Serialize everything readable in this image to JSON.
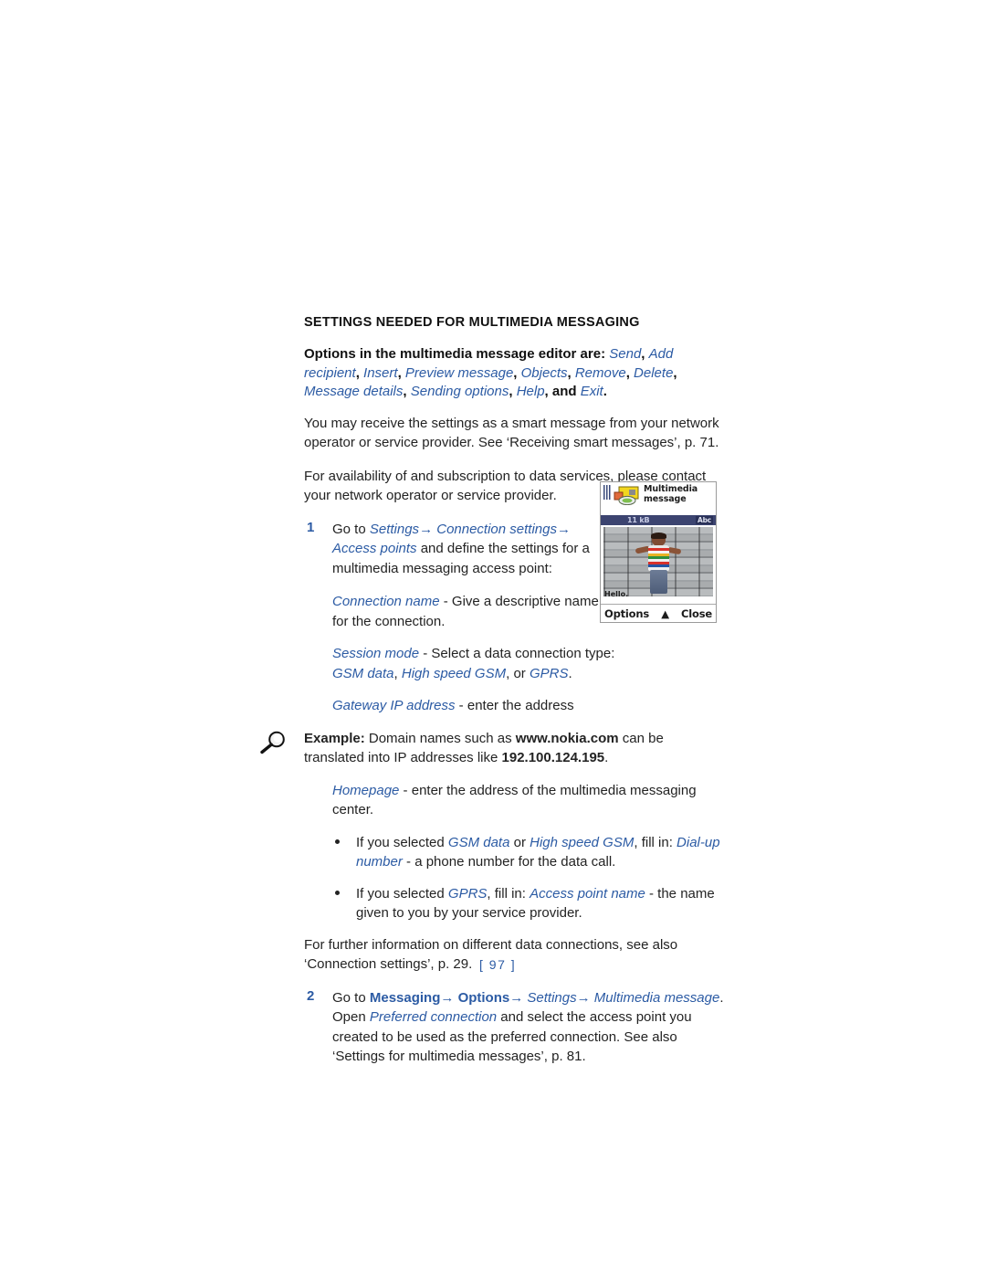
{
  "page": {
    "number_label": "[ 97 ]",
    "accent_blue": "#2c5ba4",
    "body_color": "#232323"
  },
  "section": {
    "title": "SETTINGS NEEDED FOR MULTIMEDIA MESSAGING"
  },
  "lead": {
    "prefix": "Options in the multimedia message editor are:",
    "options": [
      "Send",
      "Add recipient",
      "Insert",
      "Preview message",
      "Objects",
      "Remove",
      "Delete",
      "Message details",
      "Sending options",
      "Help",
      "Exit"
    ],
    "connector_and": ", and ",
    "terminator": "."
  },
  "paragraphs": {
    "smart_message": "You may receive the settings as a smart message from your network operator or service provider. See ‘Receiving smart messages’, p. 71.",
    "availability": "For availability of and subscription to data services, please contact your network operator or service provider.",
    "further_info": "For further information on different data connections, see also ‘Connection settings’, p. 29."
  },
  "steps": [
    {
      "number": "1",
      "text_before": "Go to ",
      "path": [
        "Settings",
        "Connection settings",
        "Access points"
      ],
      "arrow": "→",
      "text_after": " and define the settings for a multimedia messaging access point:"
    },
    {
      "number": "2",
      "text_before": "Go to ",
      "path_bold": [
        "Messaging",
        "Options"
      ],
      "path_italic": [
        "Settings",
        "Multimedia message"
      ],
      "arrow": "→",
      "text_after_1": ". Open ",
      "preferred": "Preferred connection",
      "text_after_2": " and select the access point you created to be used as the preferred connection. See also ‘Settings for multimedia messages’, p. 81."
    }
  ],
  "settings_items": [
    {
      "term": "Connection name",
      "dash": " - ",
      "desc": "Give a descriptive name for the connection."
    },
    {
      "term": "Session mode",
      "dash": " - ",
      "desc": "Select a data connection type: ",
      "values": [
        "GSM data",
        "High speed GSM",
        "GPRS"
      ],
      "value_sep_1": ", ",
      "value_sep_2": ", or ",
      "desc_end": "."
    },
    {
      "term": "Gateway IP address",
      "dash": " - ",
      "desc": "enter the address"
    },
    {
      "term": "Homepage",
      "dash": " - ",
      "desc": "enter the address of the multimedia messaging center."
    }
  ],
  "example": {
    "icon": "magnifier-icon",
    "label": "Example:",
    "text_1": " Domain names such as ",
    "domain": "www.nokia.com",
    "text_2": " can be translated into IP addresses like ",
    "ip": "192.100.124.195",
    "text_3": "."
  },
  "bullets": [
    {
      "text_1": "If you selected ",
      "term_1": "GSM data",
      "text_2": " or ",
      "term_2": "High speed GSM",
      "text_3": ", fill in: ",
      "term_3": "Dial-up number",
      "text_4": " - a phone number for the data call."
    },
    {
      "text_1": "If you selected ",
      "term_1": "GPRS",
      "text_2": ", fill in: ",
      "term_2": "Access point name",
      "text_3": " - the name given to you by your service provider."
    }
  ],
  "phone_screenshot": {
    "title_line_1": "Multimedia",
    "title_line_2": "message",
    "size": "11 kB",
    "input_mode": "Abc",
    "message_text": "Hello.",
    "left_softkey": "Options",
    "right_softkey": "Close",
    "scroll_indicator": "▲",
    "photo_description": "person-photo"
  }
}
